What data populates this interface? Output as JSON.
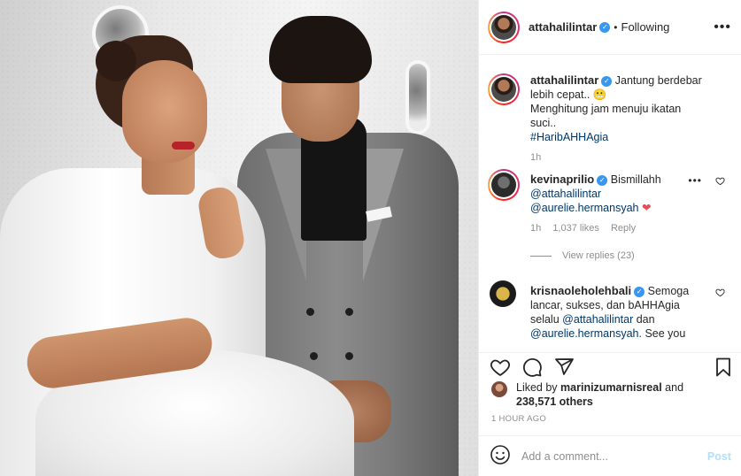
{
  "post": {
    "image_description": "",
    "author": {
      "username": "attahalilintar",
      "verified": true,
      "follow_status": "Following"
    },
    "caption": {
      "username": "attahalilintar",
      "line1": "Jantung berdebar lebih cepat..",
      "emoji": "😬",
      "line2": "Menghitung jam menuju ikatan suci..",
      "hashtag": "#HaribAHHAgia",
      "time": "1h"
    },
    "comments": [
      {
        "username": "kevinaprilio",
        "verified": true,
        "text_start": "Bismillahh",
        "mention1": "@attahalilintar",
        "mention2": "@aurelie.hermansyah",
        "emoji": "❤",
        "time": "1h",
        "likes": "1,037 likes",
        "reply": "Reply",
        "view_replies": "View replies (23)"
      },
      {
        "username": "krisnaoleholehbali",
        "verified": true,
        "text_start": "Semoga lancar, sukses, dan bAHHAgia selalu",
        "mention1": "@attahalilintar",
        "and": "dan",
        "mention2": "@aurelie.hermansyah.",
        "text_end": "See you"
      }
    ],
    "liked_by": {
      "prefix": "Liked by",
      "user": "marinizumarnisreal",
      "and": "and",
      "count": "238,571 others"
    },
    "timestamp": "1 HOUR AGO",
    "add_comment": {
      "placeholder": "Add a comment...",
      "post_label": "Post"
    }
  },
  "colors": {
    "link": "#00376b",
    "verified": "#3897f0",
    "muted": "#8e8e8e",
    "post_disabled": "#b2dffc",
    "heart_red": "#ed4956"
  },
  "icons": [
    "more-icon",
    "heart-icon",
    "comment-icon",
    "share-icon",
    "save-icon",
    "emoji-icon",
    "verified-icon"
  ]
}
